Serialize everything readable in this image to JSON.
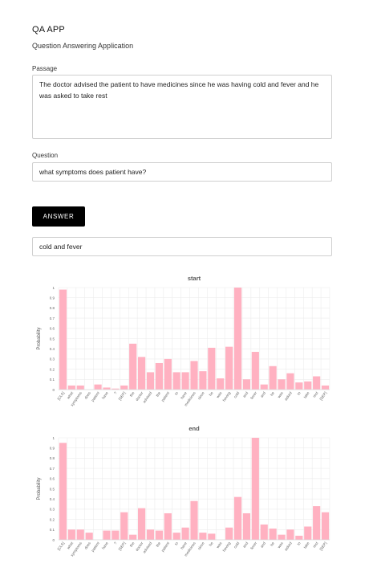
{
  "app": {
    "title": "QA APP",
    "subtitle": "Question Answering Application"
  },
  "passage": {
    "label": "Passage",
    "value": "The doctor advised the patient to have medicines since he was having cold and fever and he was asked to take rest"
  },
  "question": {
    "label": "Question",
    "value": "what symptoms does patient have?"
  },
  "answer_button": {
    "label": "ANSWER"
  },
  "answer": {
    "value": "cold and fever"
  },
  "colors": {
    "bar": "#ffb1c1",
    "bar_stroke": "#ff9fb3",
    "grid": "#ececec",
    "button": "#000000"
  },
  "chart_data": [
    {
      "type": "bar",
      "title": "start",
      "xlabel": "",
      "ylabel": "Probability",
      "ylim": [
        0,
        1
      ],
      "yticks": [
        "0",
        "0.1",
        "0.2",
        "0.3",
        "0.4",
        "0.5",
        "0.6",
        "0.7",
        "0.8",
        "0.9",
        "1"
      ],
      "grid": true,
      "categories": [
        "[CLS]",
        "what",
        "symptoms",
        "does",
        "patient",
        "have",
        "?",
        "[SEP]",
        "the",
        "doctor",
        "advised",
        "the",
        "patient",
        "to",
        "have",
        "medicines",
        "since",
        "he",
        "was",
        "having",
        "cold",
        "and",
        "fever",
        "and",
        "he",
        "was",
        "asked",
        "to",
        "take",
        "rest",
        "[SEP]"
      ],
      "values": [
        0.98,
        0.04,
        0.04,
        0.0,
        0.05,
        0.02,
        0.01,
        0.04,
        0.45,
        0.32,
        0.17,
        0.26,
        0.3,
        0.17,
        0.17,
        0.28,
        0.18,
        0.41,
        0.11,
        0.42,
        1.0,
        0.1,
        0.37,
        0.05,
        0.23,
        0.1,
        0.16,
        0.07,
        0.08,
        0.13,
        0.04
      ]
    },
    {
      "type": "bar",
      "title": "end",
      "xlabel": "",
      "ylabel": "Probability",
      "ylim": [
        0,
        1
      ],
      "yticks": [
        "0",
        "0.1",
        "0.2",
        "0.3",
        "0.4",
        "0.5",
        "0.6",
        "0.7",
        "0.8",
        "0.9",
        "1"
      ],
      "grid": true,
      "categories": [
        "[CLS]",
        "what",
        "symptoms",
        "does",
        "patient",
        "have",
        "?",
        "[SEP]",
        "the",
        "doctor",
        "advised",
        "the",
        "patient",
        "to",
        "have",
        "medicines",
        "since",
        "he",
        "was",
        "having",
        "cold",
        "and",
        "fever",
        "and",
        "he",
        "was",
        "asked",
        "to",
        "take",
        "rest",
        "[SEP]"
      ],
      "values": [
        0.95,
        0.1,
        0.1,
        0.07,
        0.0,
        0.09,
        0.09,
        0.27,
        0.05,
        0.31,
        0.1,
        0.09,
        0.26,
        0.07,
        0.12,
        0.38,
        0.07,
        0.06,
        0.0,
        0.12,
        0.42,
        0.26,
        1.0,
        0.15,
        0.11,
        0.05,
        0.1,
        0.04,
        0.13,
        0.33,
        0.27
      ]
    }
  ]
}
